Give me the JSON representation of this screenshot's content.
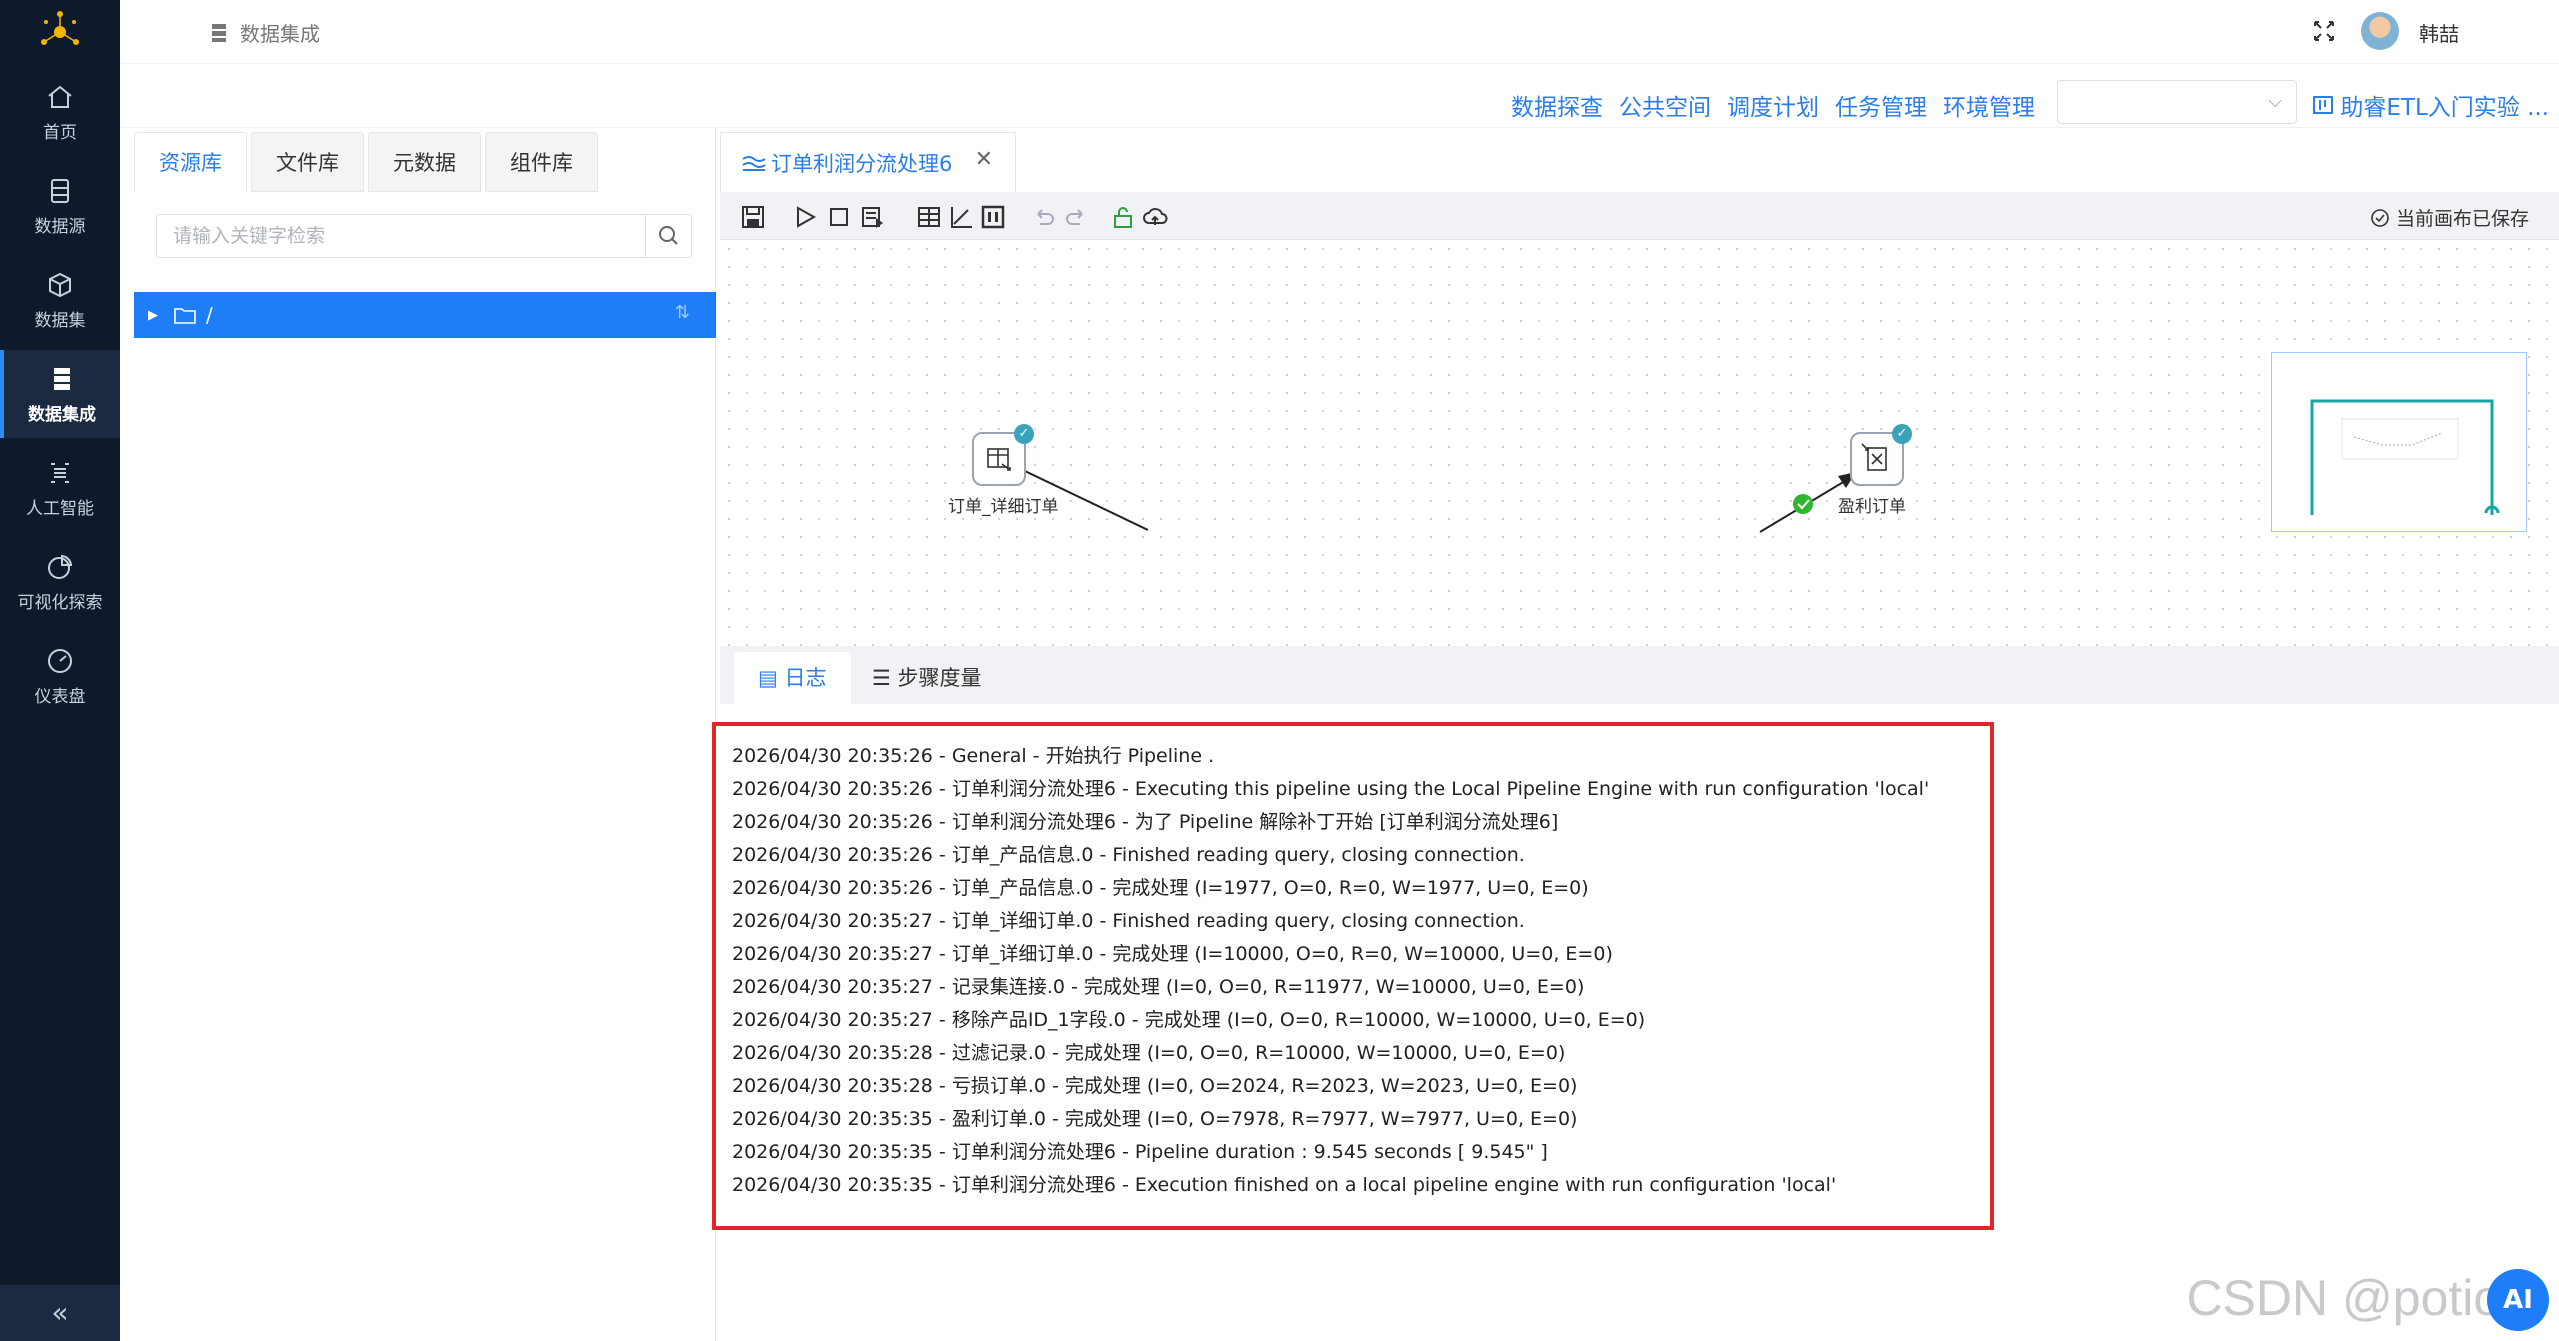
{
  "sidebar": {
    "items": [
      {
        "label": "首页",
        "icon": "home-icon"
      },
      {
        "label": "数据源",
        "icon": "database-icon"
      },
      {
        "label": "数据集",
        "icon": "cube-icon"
      },
      {
        "label": "数据集成",
        "icon": "server-icon",
        "active": true
      },
      {
        "label": "人工智能",
        "icon": "ai-icon"
      },
      {
        "label": "可视化探索",
        "icon": "pie-chart-icon"
      },
      {
        "label": "仪表盘",
        "icon": "gauge-icon"
      }
    ],
    "collapse": "«"
  },
  "header": {
    "breadcrumb": "数据集成",
    "username": "韩喆"
  },
  "links": {
    "explore": "数据探查",
    "public_space": "公共空间",
    "schedule": "调度计划",
    "tasks": "任务管理",
    "env": "环境管理",
    "help": "助睿ETL入门实验 ..."
  },
  "resource_tabs": [
    "资源库",
    "文件库",
    "元数据",
    "组件库"
  ],
  "search": {
    "placeholder": "请输入关键字检索"
  },
  "tree": {
    "root": "/"
  },
  "editor": {
    "tab_title": "订单利润分流处理6",
    "saved_status": "当前画布已保存"
  },
  "canvas": {
    "node_left_label": "订单_详细订单",
    "node_right_label": "盈利订单"
  },
  "log_tabs": [
    "日志",
    "步骤度量"
  ],
  "log_lines": [
    "2026/04/30 20:35:26 - General - 开始执行 Pipeline .",
    "2026/04/30 20:35:26 - 订单利润分流处理6 - Executing this pipeline using the Local Pipeline Engine with run configuration 'local'",
    "2026/04/30 20:35:26 - 订单利润分流处理6 - 为了 Pipeline 解除补丁开始 [订单利润分流处理6]",
    "2026/04/30 20:35:26 - 订单_产品信息.0 - Finished reading query, closing connection.",
    "2026/04/30 20:35:26 - 订单_产品信息.0 - 完成处理 (I=1977, O=0, R=0, W=1977, U=0, E=0)",
    "2026/04/30 20:35:27 - 订单_详细订单.0 - Finished reading query, closing connection.",
    "2026/04/30 20:35:27 - 订单_详细订单.0 - 完成处理 (I=10000, O=0, R=0, W=10000, U=0, E=0)",
    "2026/04/30 20:35:27 - 记录集连接.0 - 完成处理 (I=0, O=0, R=11977, W=10000, U=0, E=0)",
    "2026/04/30 20:35:27 - 移除产品ID_1字段.0 - 完成处理 (I=0, O=0, R=10000, W=10000, U=0, E=0)",
    "2026/04/30 20:35:28 - 过滤记录.0 - 完成处理 (I=0, O=0, R=10000, W=10000, U=0, E=0)",
    "2026/04/30 20:35:28 - 亏损订单.0 - 完成处理 (I=0, O=2024, R=2023, W=2023, U=0, E=0)",
    "2026/04/30 20:35:35 - 盈利订单.0 - 完成处理 (I=0, O=7978, R=7977, W=7977, U=0, E=0)",
    "2026/04/30 20:35:35 - 订单利润分流处理6 - Pipeline duration : 9.545 seconds [  9.545\" ]",
    "2026/04/30 20:35:35 - 订单利润分流处理6 - Execution finished on a local pipeline engine with run configuration 'local'"
  ],
  "watermark": "CSDN @potion",
  "ai_button": "AI",
  "colors": {
    "sidebar": "#0e1a2b",
    "accent": "#2b7de9",
    "selected_row": "#1e7ef7",
    "highlight_border": "#e0262b"
  }
}
